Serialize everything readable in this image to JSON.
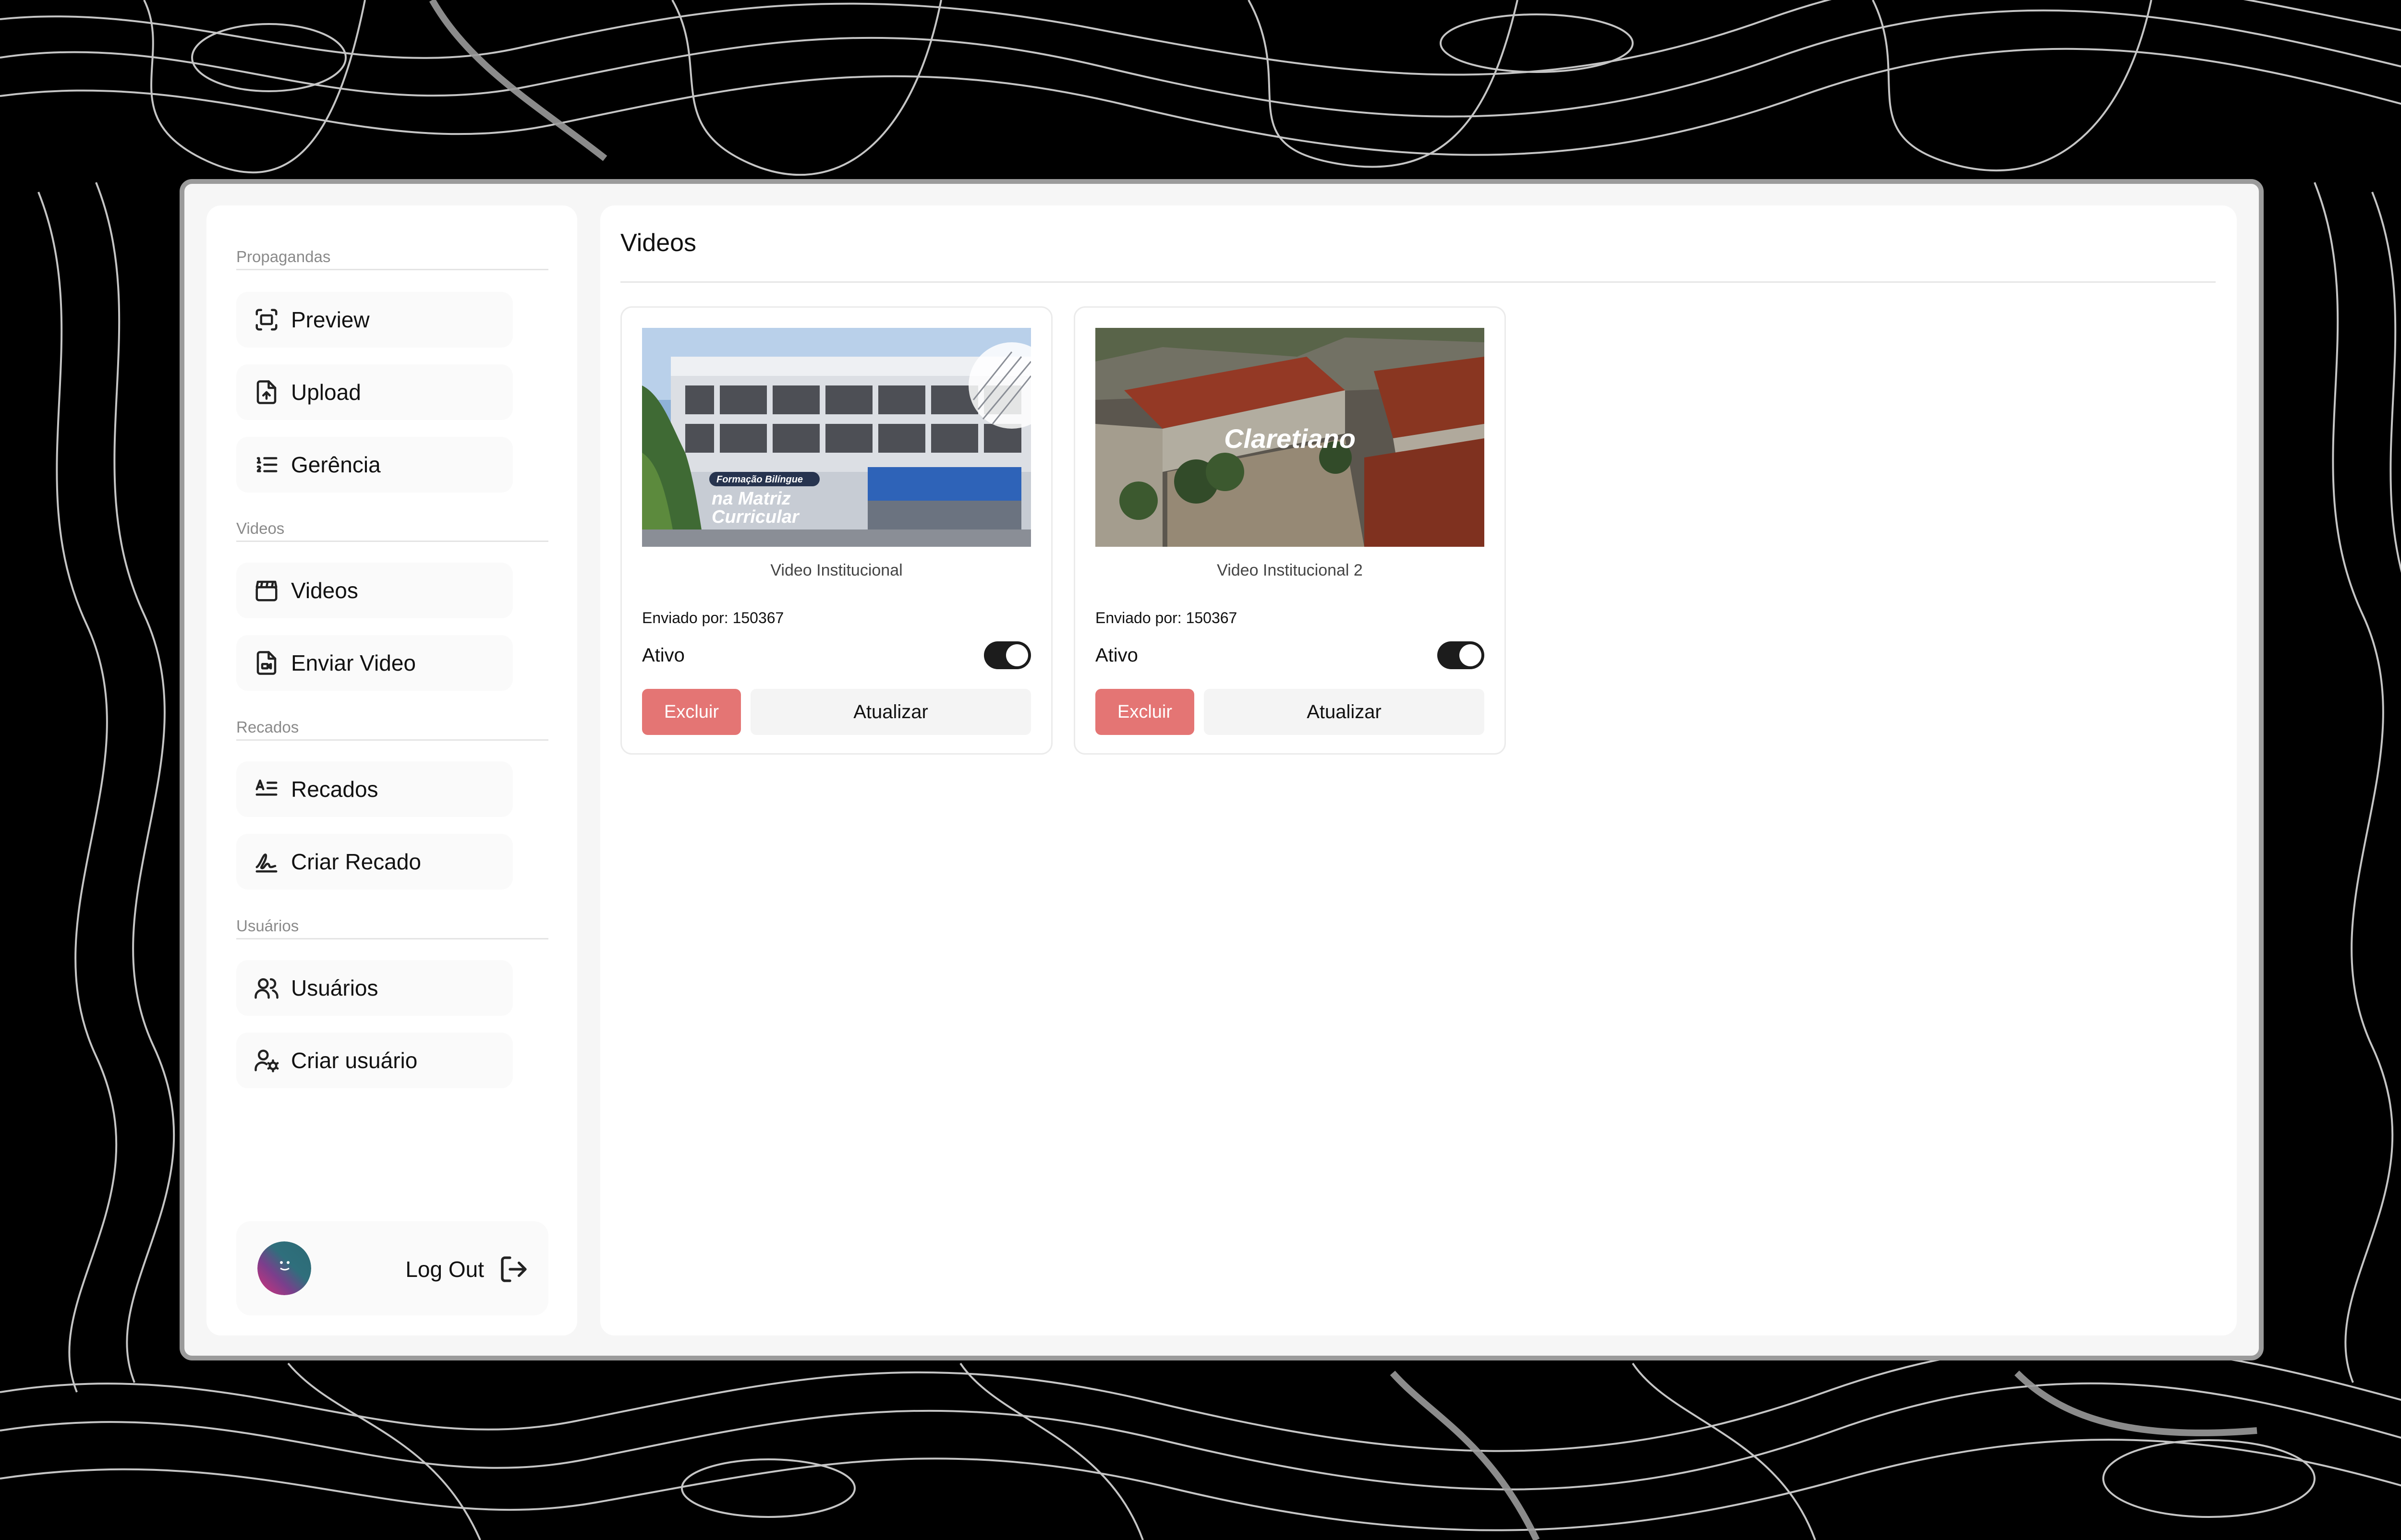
{
  "sidebar": {
    "sections": [
      {
        "label": "Propagandas"
      },
      {
        "label": "Videos"
      },
      {
        "label": "Recados"
      },
      {
        "label": "Usuários"
      }
    ],
    "items": [
      {
        "label": "Preview",
        "icon": "scan-icon"
      },
      {
        "label": "Upload",
        "icon": "file-upload-icon"
      },
      {
        "label": "Gerência",
        "icon": "list-ordered-icon"
      },
      {
        "label": "Videos",
        "icon": "clapperboard-icon"
      },
      {
        "label": "Enviar Video",
        "icon": "file-video-icon"
      },
      {
        "label": "Recados",
        "icon": "text-align-icon"
      },
      {
        "label": "Criar Recado",
        "icon": "signature-icon"
      },
      {
        "label": "Usuários",
        "icon": "users-icon"
      },
      {
        "label": "Criar usuário",
        "icon": "user-cog-icon"
      }
    ],
    "logout_label": "Log Out"
  },
  "main": {
    "title": "Videos",
    "cards": [
      {
        "title": "Video Institucional",
        "sent_by": "Enviado por: 150367",
        "status_label": "Ativo",
        "active": true,
        "delete_label": "Excluir",
        "update_label": "Atualizar",
        "thumb_text": [
          "Formação Bilíngue",
          "na Matriz",
          "Curricular"
        ]
      },
      {
        "title": "Video Institucional 2",
        "sent_by": "Enviado por: 150367",
        "status_label": "Ativo",
        "active": true,
        "delete_label": "Excluir",
        "update_label": "Atualizar",
        "thumb_text": [
          "Claretiano"
        ]
      }
    ]
  },
  "colors": {
    "delete_button": "#e47574",
    "toggle_on": "#1c1c1c",
    "page_background": "#000000"
  }
}
